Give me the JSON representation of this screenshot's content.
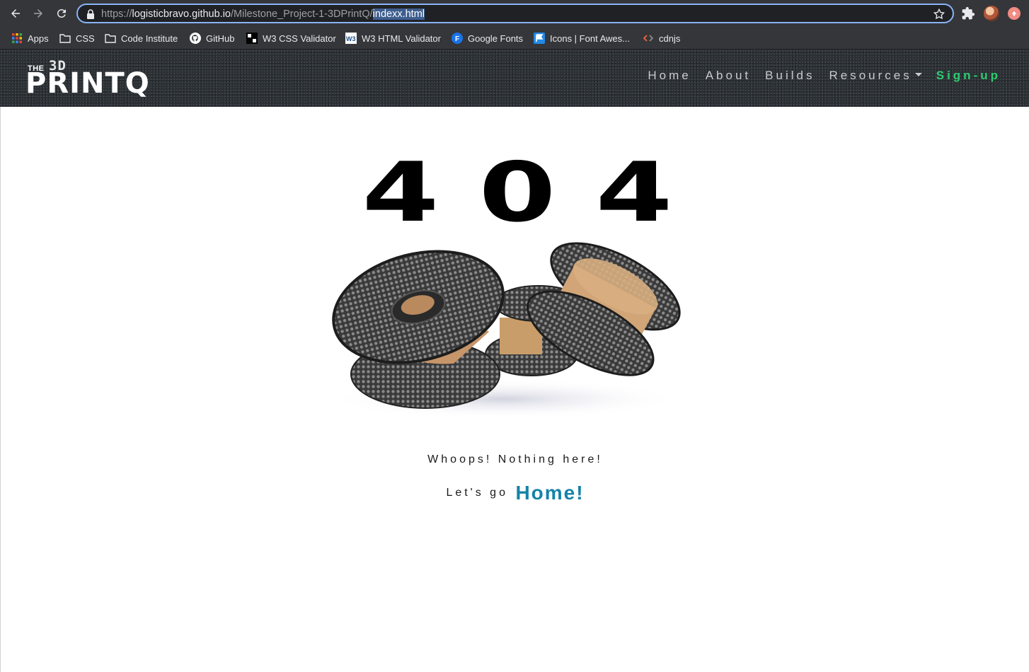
{
  "browser": {
    "url": {
      "scheme": "https://",
      "host": "logisticbravo.github.io",
      "path": "/Milestone_Project-1-3DPrintQ/",
      "selected": "indexx.html"
    },
    "bookmarks": [
      {
        "label": "Apps",
        "icon": "apps-grid-icon"
      },
      {
        "label": "CSS",
        "icon": "folder-icon"
      },
      {
        "label": "Code Institute",
        "icon": "folder-icon"
      },
      {
        "label": "GitHub",
        "icon": "github-icon"
      },
      {
        "label": "W3 CSS Validator",
        "icon": "w3-css-icon"
      },
      {
        "label": "W3 HTML Validator",
        "icon": "w3-html-icon"
      },
      {
        "label": "Google Fonts",
        "icon": "google-fonts-icon"
      },
      {
        "label": "Icons | Font Awes...",
        "icon": "font-awesome-icon"
      },
      {
        "label": "cdnjs",
        "icon": "cdnjs-icon"
      }
    ]
  },
  "site": {
    "logo": {
      "the": "THE",
      "three": "3D",
      "printq": "PRINTQ"
    },
    "nav": {
      "home": "Home",
      "about": "About",
      "builds": "Builds",
      "resources": "Resources",
      "signup": "Sign-up"
    },
    "colors": {
      "signup": "#2ecc71",
      "home_link": "#1583a8",
      "header_bg": "#2c3136"
    }
  },
  "error": {
    "digits": [
      "4",
      "0",
      "4"
    ],
    "message": "Whoops! Nothing here!",
    "lets_go": "Let's go",
    "home_link": "Home!"
  }
}
